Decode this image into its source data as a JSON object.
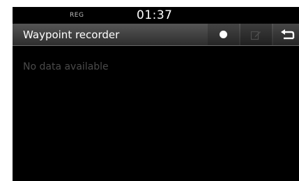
{
  "status_bar": {
    "indicator": "REG",
    "time": "01:37"
  },
  "header": {
    "title": "Waypoint recorder",
    "buttons": {
      "record": {
        "icon": "record-dot-icon"
      },
      "edit": {
        "icon": "edit-icon",
        "enabled": false
      },
      "back": {
        "icon": "back-arrow-icon"
      }
    }
  },
  "content": {
    "empty_message": "No data available"
  }
}
